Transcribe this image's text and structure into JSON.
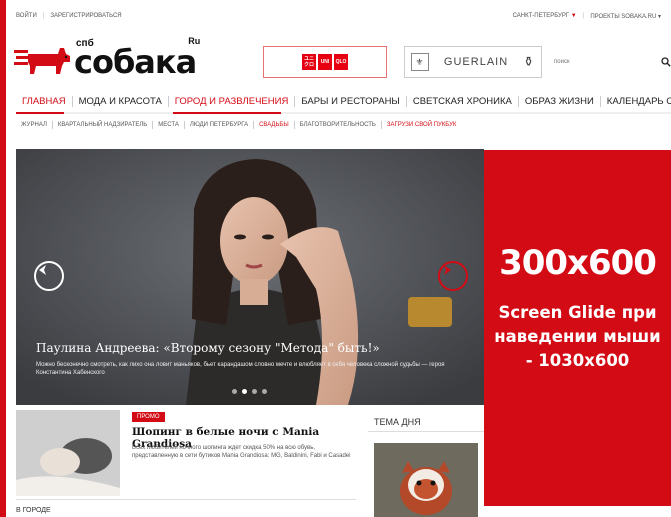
{
  "topbar": {
    "login": "войти",
    "register": "зарегистрироваться",
    "city": "санкт-петербург",
    "projects": "проекты sobaka.ru"
  },
  "logo": {
    "spb": "спб",
    "name": "собака",
    "ru": "Ru"
  },
  "ads": {
    "uniqlo_left": "UNI",
    "uniqlo_right": "QLO",
    "guerlain": "GUERLAIN"
  },
  "search": {
    "placeholder": "поиск"
  },
  "main_nav": [
    {
      "label": "главная",
      "active": true
    },
    {
      "label": "мода и красота"
    },
    {
      "label": "город и развлечения",
      "highlight": true
    },
    {
      "label": "бары и рестораны"
    },
    {
      "label": "светская хроника"
    },
    {
      "label": "образ жизни"
    },
    {
      "label": "календарь событий"
    }
  ],
  "sub_nav": [
    {
      "label": "журнал"
    },
    {
      "label": "квартальный надзиратель"
    },
    {
      "label": "места"
    },
    {
      "label": "люди петербурга"
    },
    {
      "label": "свадьбы",
      "red": true
    },
    {
      "label": "благотворительность"
    },
    {
      "label": "загрузи свой пукбук",
      "red": true
    }
  ],
  "hero": {
    "title": "Паулина Андреева: «Второму сезону \"Метода\" быть!»",
    "description": "Можно бесконечно смотреть, как лихо она ловит маньяков, бьет карандашом словно мечте и влюбляет в себя человека сложной судьбы — героя Константина Хабенского"
  },
  "promo": {
    "badge": "промо",
    "title": "Шопинг в белые ночи с Mania Grandiosa",
    "text": "Всех любителей ночного шопинга ждет скидка 50% на всю обувь, представленную в сети бутиков Mania Grandiosa: MG, Baldinini, Fabi и Casadei"
  },
  "section_label": "в городе",
  "theme_day": {
    "label": "тема дня"
  },
  "banner": {
    "size": "300x600",
    "text": "Screen Glide при наведении мыши - 1030x600"
  },
  "colors": {
    "brand_red": "#d30b15"
  }
}
